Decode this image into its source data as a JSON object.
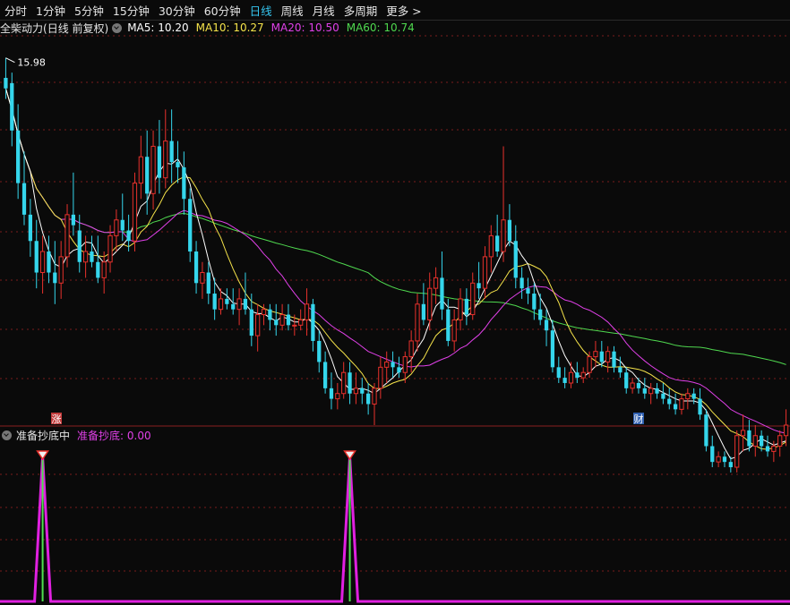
{
  "timeframes": [
    "分时",
    "1分钟",
    "5分钟",
    "15分钟",
    "30分钟",
    "60分钟",
    "日线",
    "周线",
    "月线",
    "多周期",
    "更多 >"
  ],
  "active_timeframe": "日线",
  "stock": {
    "name": "全柴动力",
    "mode": "(日线 前复权)"
  },
  "ma_legend": [
    {
      "label": "MA5: 10.20",
      "color": "#ffffff"
    },
    {
      "label": "MA10: 10.27",
      "color": "#f5e34a"
    },
    {
      "label": "MA20: 10.50",
      "color": "#e040e8"
    },
    {
      "label": "MA60: 10.74",
      "color": "#4fd84f"
    }
  ],
  "high_marker": "15.98",
  "event_markers": [
    {
      "label": "涨",
      "color": "#c23b3b"
    },
    {
      "label": "财",
      "color": "#2f5fb0"
    }
  ],
  "indicator": {
    "name": "准备抄底中",
    "value_label": "准备抄底: 0.00",
    "value_color": "#e040e8"
  },
  "colors": {
    "up": "#e8312c",
    "down": "#35d6ec",
    "grid": "#7a1c1c"
  },
  "chart_data": {
    "type": "candlestick",
    "y_scale": [
      9.0,
      16.4
    ],
    "ohlc": [
      [
        15.6,
        15.98,
        15.2,
        15.4
      ],
      [
        15.5,
        15.7,
        14.3,
        14.6
      ],
      [
        14.6,
        15.1,
        13.3,
        13.6
      ],
      [
        13.6,
        14.2,
        12.8,
        13.0
      ],
      [
        13.0,
        13.3,
        12.2,
        12.5
      ],
      [
        12.5,
        12.9,
        11.6,
        11.9
      ],
      [
        11.9,
        12.6,
        11.5,
        12.3
      ],
      [
        12.3,
        12.6,
        11.7,
        11.9
      ],
      [
        11.9,
        12.5,
        11.3,
        11.7
      ],
      [
        11.7,
        12.5,
        11.4,
        12.2
      ],
      [
        12.2,
        13.2,
        12.0,
        13.0
      ],
      [
        13.0,
        13.8,
        12.6,
        12.8
      ],
      [
        12.7,
        13.0,
        11.9,
        12.1
      ],
      [
        12.1,
        12.6,
        11.8,
        12.3
      ],
      [
        12.3,
        12.6,
        12.0,
        12.1
      ],
      [
        12.1,
        12.6,
        11.7,
        11.8
      ],
      [
        11.8,
        12.3,
        11.5,
        12.1
      ],
      [
        12.1,
        12.8,
        11.9,
        12.6
      ],
      [
        12.6,
        13.1,
        12.3,
        12.9
      ],
      [
        12.9,
        13.4,
        12.5,
        12.7
      ],
      [
        12.7,
        13.0,
        12.3,
        12.5
      ],
      [
        12.5,
        13.8,
        12.3,
        13.6
      ],
      [
        13.6,
        14.5,
        13.3,
        14.1
      ],
      [
        14.1,
        14.6,
        13.0,
        13.4
      ],
      [
        13.4,
        14.6,
        13.1,
        14.3
      ],
      [
        14.3,
        14.8,
        13.4,
        13.7
      ],
      [
        13.7,
        15.0,
        13.5,
        14.4
      ],
      [
        14.4,
        15.0,
        13.6,
        14.0
      ],
      [
        14.0,
        14.4,
        13.6,
        13.9
      ],
      [
        13.9,
        14.2,
        13.0,
        13.3
      ],
      [
        13.3,
        13.5,
        12.1,
        12.3
      ],
      [
        12.3,
        12.5,
        11.5,
        11.7
      ],
      [
        11.7,
        12.1,
        11.4,
        11.9
      ],
      [
        11.9,
        12.1,
        11.3,
        11.5
      ],
      [
        11.5,
        11.8,
        11.0,
        11.2
      ],
      [
        11.2,
        11.6,
        11.1,
        11.4
      ],
      [
        11.4,
        11.6,
        11.2,
        11.3
      ],
      [
        11.3,
        11.6,
        11.1,
        11.2
      ],
      [
        11.2,
        11.6,
        10.9,
        11.4
      ],
      [
        11.4,
        11.9,
        11.1,
        11.2
      ],
      [
        11.2,
        11.5,
        10.5,
        10.7
      ],
      [
        10.7,
        11.3,
        10.4,
        11.1
      ],
      [
        11.1,
        11.3,
        10.9,
        11.2
      ],
      [
        11.2,
        11.3,
        10.8,
        11.0
      ],
      [
        11.0,
        11.3,
        10.7,
        10.9
      ],
      [
        10.9,
        11.3,
        10.8,
        11.1
      ],
      [
        11.1,
        11.3,
        10.8,
        10.9
      ],
      [
        10.9,
        11.1,
        10.7,
        10.9
      ],
      [
        10.9,
        11.2,
        10.8,
        11.0
      ],
      [
        11.0,
        11.6,
        10.7,
        11.3
      ],
      [
        11.3,
        11.4,
        10.4,
        10.6
      ],
      [
        10.6,
        10.8,
        10.0,
        10.2
      ],
      [
        10.2,
        10.4,
        9.6,
        9.7
      ],
      [
        9.7,
        10.0,
        9.3,
        9.5
      ],
      [
        9.5,
        9.8,
        9.3,
        9.6
      ],
      [
        9.6,
        10.2,
        9.5,
        10.0
      ],
      [
        10.0,
        10.2,
        9.4,
        9.6
      ],
      [
        9.6,
        10.0,
        9.4,
        9.7
      ],
      [
        9.7,
        9.9,
        9.4,
        9.6
      ],
      [
        9.6,
        9.8,
        9.2,
        9.4
      ],
      [
        9.4,
        9.8,
        9.0,
        9.7
      ],
      [
        9.7,
        10.3,
        9.5,
        10.1
      ],
      [
        10.1,
        10.4,
        9.8,
        10.2
      ],
      [
        10.2,
        10.4,
        9.9,
        10.1
      ],
      [
        10.1,
        10.3,
        9.9,
        10.0
      ],
      [
        10.0,
        10.4,
        9.8,
        10.3
      ],
      [
        10.3,
        10.8,
        10.0,
        10.6
      ],
      [
        10.6,
        11.5,
        10.4,
        11.3
      ],
      [
        11.3,
        11.7,
        10.9,
        11.0
      ],
      [
        11.0,
        11.9,
        10.8,
        11.6
      ],
      [
        11.6,
        12.0,
        11.3,
        11.8
      ],
      [
        11.8,
        12.3,
        11.0,
        11.2
      ],
      [
        11.2,
        11.4,
        10.5,
        10.6
      ],
      [
        10.6,
        11.2,
        10.4,
        11.0
      ],
      [
        11.0,
        11.6,
        10.8,
        11.4
      ],
      [
        11.4,
        11.6,
        10.9,
        11.1
      ],
      [
        11.1,
        11.9,
        11.0,
        11.7
      ],
      [
        11.7,
        12.1,
        11.4,
        11.6
      ],
      [
        11.6,
        12.4,
        11.4,
        12.2
      ],
      [
        12.2,
        12.8,
        11.9,
        12.6
      ],
      [
        12.6,
        13.0,
        12.2,
        12.3
      ],
      [
        12.3,
        14.3,
        12.1,
        12.9
      ],
      [
        12.9,
        13.2,
        12.4,
        12.5
      ],
      [
        12.5,
        12.8,
        11.6,
        11.8
      ],
      [
        11.8,
        12.0,
        11.4,
        11.6
      ],
      [
        11.6,
        11.8,
        11.3,
        11.5
      ],
      [
        11.5,
        11.7,
        11.0,
        11.2
      ],
      [
        11.2,
        11.5,
        10.9,
        11.0
      ],
      [
        11.0,
        11.2,
        10.5,
        10.8
      ],
      [
        10.8,
        11.0,
        10.0,
        10.1
      ],
      [
        10.1,
        10.3,
        9.8,
        9.9
      ],
      [
        9.9,
        10.1,
        9.7,
        9.8
      ],
      [
        9.8,
        10.2,
        9.7,
        10.0
      ],
      [
        10.0,
        10.2,
        9.8,
        9.9
      ],
      [
        9.9,
        10.1,
        9.8,
        10.0
      ],
      [
        10.0,
        10.4,
        9.9,
        10.3
      ],
      [
        10.3,
        10.6,
        10.1,
        10.4
      ],
      [
        10.4,
        10.6,
        10.1,
        10.2
      ],
      [
        10.2,
        10.5,
        10.0,
        10.4
      ],
      [
        10.4,
        10.5,
        10.0,
        10.1
      ],
      [
        10.1,
        10.3,
        9.9,
        10.0
      ],
      [
        10.0,
        10.1,
        9.6,
        9.7
      ],
      [
        9.7,
        9.9,
        9.6,
        9.8
      ],
      [
        9.8,
        9.9,
        9.6,
        9.7
      ],
      [
        9.7,
        9.9,
        9.5,
        9.6
      ],
      [
        9.6,
        9.8,
        9.4,
        9.7
      ],
      [
        9.7,
        9.8,
        9.5,
        9.6
      ],
      [
        9.6,
        9.8,
        9.4,
        9.5
      ],
      [
        9.5,
        9.7,
        9.3,
        9.4
      ],
      [
        9.4,
        9.6,
        9.2,
        9.3
      ],
      [
        9.3,
        9.6,
        9.2,
        9.5
      ],
      [
        9.5,
        9.7,
        9.3,
        9.6
      ],
      [
        9.6,
        9.7,
        9.4,
        9.5
      ],
      [
        9.5,
        9.7,
        9.1,
        9.2
      ],
      [
        9.2,
        9.3,
        8.5,
        8.6
      ],
      [
        8.6,
        8.8,
        8.2,
        8.3
      ],
      [
        8.3,
        8.5,
        8.2,
        8.4
      ],
      [
        8.4,
        8.5,
        8.2,
        8.3
      ],
      [
        8.3,
        8.4,
        8.1,
        8.2
      ],
      [
        8.2,
        8.9,
        8.1,
        8.8
      ],
      [
        8.8,
        9.2,
        8.5,
        8.9
      ],
      [
        8.9,
        9.1,
        8.5,
        8.6
      ],
      [
        8.6,
        9.0,
        8.4,
        8.8
      ],
      [
        8.8,
        8.9,
        8.5,
        8.6
      ],
      [
        8.6,
        8.8,
        8.4,
        8.5
      ],
      [
        8.5,
        8.7,
        8.3,
        8.6
      ],
      [
        8.6,
        8.9,
        8.4,
        8.8
      ],
      [
        8.8,
        9.3,
        8.6,
        9.0
      ]
    ],
    "indicator_spikes": [
      6,
      56
    ],
    "indicator_range": [
      0,
      1
    ]
  }
}
